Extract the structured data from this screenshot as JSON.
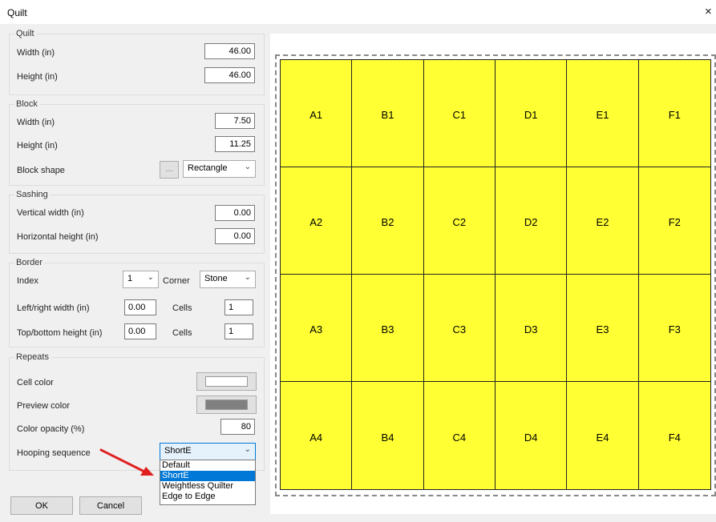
{
  "window": {
    "title": "Quilt",
    "close": "×"
  },
  "quilt": {
    "group": "Quilt",
    "width_label": "Width (in)",
    "width_value": "46.00",
    "height_label": "Height (in)",
    "height_value": "46.00"
  },
  "block": {
    "group": "Block",
    "width_label": "Width (in)",
    "width_value": "7.50",
    "height_label": "Height (in)",
    "height_value": "11.25",
    "shape_label": "Block shape",
    "shape_button": "...",
    "shape_value": "Rectangle"
  },
  "sashing": {
    "group": "Sashing",
    "vertical_label": "Vertical width (in)",
    "vertical_value": "0.00",
    "horizontal_label": "Horizontal height (in)",
    "horizontal_value": "0.00"
  },
  "border": {
    "group": "Border",
    "index_label": "Index",
    "index_value": "1",
    "corner_label": "Corner",
    "corner_value": "Stone",
    "lr_label": "Left/right width (in)",
    "lr_value": "0.00",
    "lr_cells_label": "Cells",
    "lr_cells_value": "1",
    "tb_label": "Top/bottom height (in)",
    "tb_value": "0.00",
    "tb_cells_label": "Cells",
    "tb_cells_value": "1"
  },
  "repeats": {
    "group": "Repeats",
    "cell_color_label": "Cell color",
    "cell_color": "#ffffff",
    "preview_color_label": "Preview color",
    "preview_color": "#808080",
    "opacity_label": "Color opacity (%)",
    "opacity_value": "80",
    "hooping_label": "Hooping sequence",
    "hooping_value": "ShortE",
    "hooping_options": [
      "Default",
      "ShortE",
      "Weightless Quilter",
      "Edge to Edge"
    ]
  },
  "buttons": {
    "ok": "OK",
    "cancel": "Cancel"
  },
  "preview": {
    "block_color": "#ffff33",
    "columns": [
      "A",
      "B",
      "C",
      "D",
      "E",
      "F"
    ],
    "rows": [
      [
        "A1",
        "B1",
        "C1",
        "D1",
        "E1",
        "F1"
      ],
      [
        "A2",
        "B2",
        "C2",
        "D2",
        "E2",
        "F2"
      ],
      [
        "A3",
        "B3",
        "C3",
        "D3",
        "E3",
        "F3"
      ],
      [
        "A4",
        "B4",
        "C4",
        "D4",
        "E4",
        "F4"
      ]
    ]
  },
  "annotation": {
    "arrow_color": "#e02020"
  }
}
